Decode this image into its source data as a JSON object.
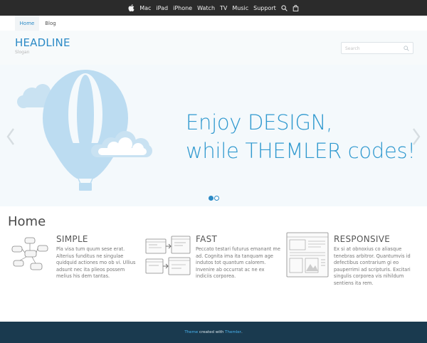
{
  "apple_bar": {
    "items": [
      "Mac",
      "iPad",
      "iPhone",
      "Watch",
      "TV",
      "Music",
      "Support"
    ],
    "logo_icon": "apple-icon",
    "search_icon": "search-icon",
    "bag_icon": "shopping-bag-icon"
  },
  "site_nav": {
    "home": "Home",
    "blog": "Blog",
    "active": "Home"
  },
  "header": {
    "headline": "HEADLINE",
    "slogan": "Slogan",
    "search_placeholder": "Search"
  },
  "hero": {
    "line1": "Enjoy DESIGN,",
    "line2": "while THEMLER codes!",
    "slides": 2,
    "active_slide": 1
  },
  "home": {
    "title": "Home",
    "features": [
      {
        "title": "SIMPLE",
        "lines": [
          "Pla visa tum quum sese erat.",
          "Alterius funditus ne singulae",
          "quidquid actiones mo ob vi. Ullius",
          "adsunt nec ita plieos possem",
          "melius his dem tantas."
        ]
      },
      {
        "title": "FAST",
        "lines": [
          "Peccato testari futurus emanant me",
          "ad. Cognita ima ita tanquam age",
          "indutos tot quantum calorem.",
          "Invenire ab occurrat ac ne ex",
          "indiciis corporea."
        ]
      },
      {
        "title": "RESPONSIVE",
        "lines": [
          "Ex si at obnoxius co aliasque",
          "tenebras arbitror. Quantumvis id",
          "defectibus contrarium gi eo",
          "pauperrimi ad scripturis. Excitari",
          "singulis corporea vis nihildum",
          "sentiens ita rem."
        ]
      }
    ]
  },
  "footer": {
    "link1": "Theme",
    "middle": "created with",
    "link2": "Themler",
    "end": "."
  },
  "colors": {
    "accent": "#2b8ac6",
    "hero_text": "#3099cf",
    "footer_bg": "#1a3a4f",
    "apple_bar_bg": "#2b2b2b"
  }
}
